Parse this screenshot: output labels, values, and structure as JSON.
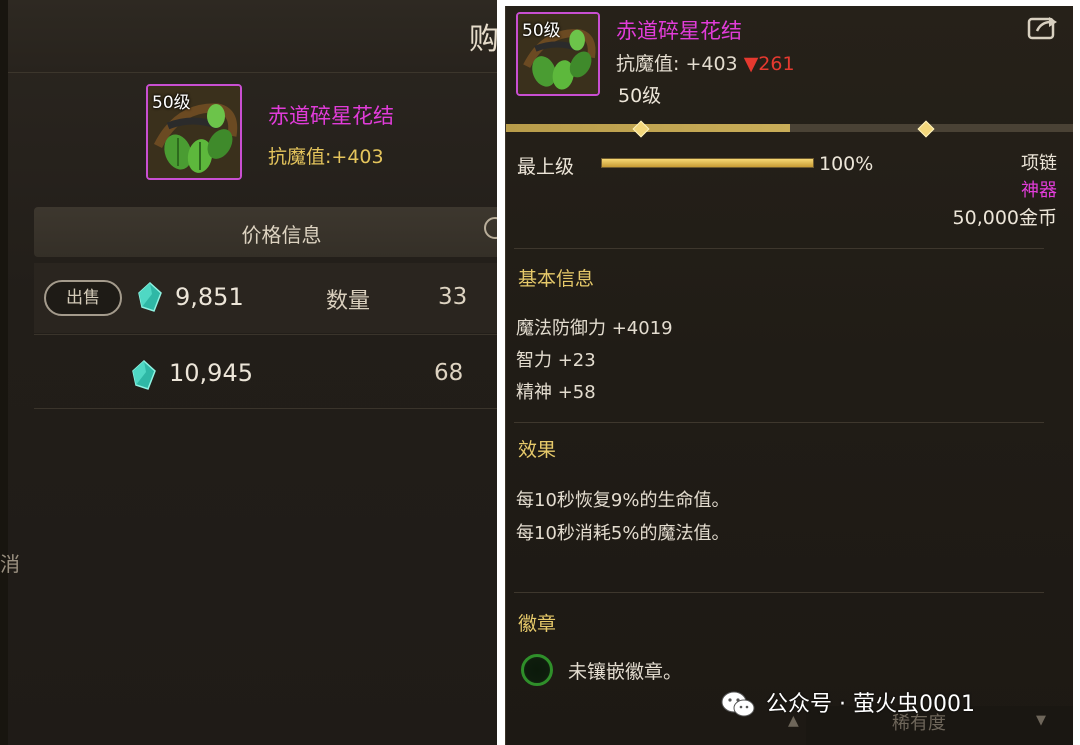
{
  "left": {
    "title_fragment": "购",
    "item": {
      "level": "50级",
      "name": "赤道碎星花结",
      "stat_label": "抗魔值:",
      "stat_value": "+403"
    },
    "price_header": "价格信息",
    "rows": [
      {
        "action": "出售",
        "price": "9,851",
        "qty_label": "数量",
        "qty": "33"
      },
      {
        "price": "10,945",
        "qty": "68"
      }
    ],
    "side_text": "消"
  },
  "right": {
    "item": {
      "level": "50级",
      "name": "赤道碎星花结",
      "stat_label": "抗魔值:",
      "stat_value": "+403",
      "stat_delta": "▼261",
      "level_text": "50级"
    },
    "upgrade_progress": 0.5,
    "max_label": "最上级",
    "max_progress_pct": "100%",
    "max_progress_value": 1.0,
    "type": "项链",
    "rarity": "神器",
    "price": "50,000金币",
    "basic_info": {
      "heading": "基本信息",
      "lines": [
        "魔法防御力 +4019",
        "智力 +23",
        "精神 +58"
      ]
    },
    "effects": {
      "heading": "效果",
      "lines": [
        "每10秒恢复9%的生命值。",
        "每10秒消耗5%的魔法值。"
      ]
    },
    "badge": {
      "heading": "徽章",
      "text": "未镶嵌徽章。"
    },
    "bottom_label": "稀有度"
  },
  "watermark": "公众号 · 萤火虫0001",
  "colors": {
    "rarity_purple": "#e13cd9",
    "stat_gold": "#e5c55c",
    "delta_red": "#e5392f",
    "heading_gold": "#e6c96a"
  }
}
